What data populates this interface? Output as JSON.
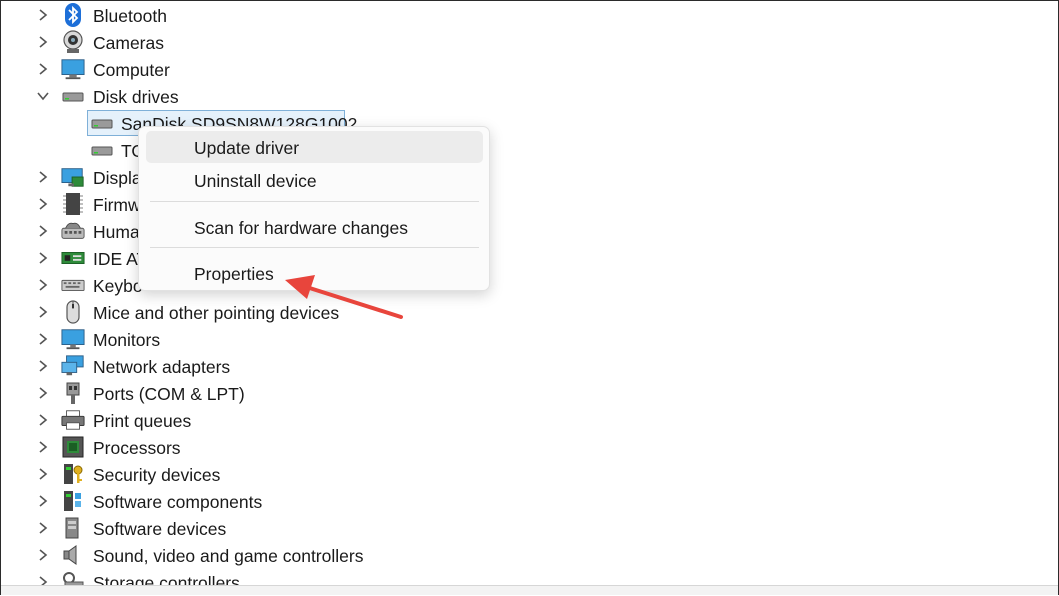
{
  "tree": {
    "items": [
      {
        "label": "Bluetooth",
        "icon": "bluetooth-icon",
        "expanded": false
      },
      {
        "label": "Cameras",
        "icon": "camera-icon",
        "expanded": false
      },
      {
        "label": "Computer",
        "icon": "computer-icon",
        "expanded": false
      },
      {
        "label": "Disk drives",
        "icon": "disk-drive-icon",
        "expanded": true
      },
      {
        "label": "SanDisk SD9SN8W128G1002",
        "icon": "disk-drive-icon",
        "child": true,
        "selected": true
      },
      {
        "label": "TO",
        "icon": "disk-drive-icon",
        "child": true
      },
      {
        "label": "Displa",
        "icon": "display-adapter-icon",
        "expanded": false
      },
      {
        "label": "Firmw",
        "icon": "firmware-icon",
        "expanded": false
      },
      {
        "label": "Huma",
        "icon": "hid-icon",
        "expanded": false
      },
      {
        "label": "IDE AT",
        "icon": "ide-controller-icon",
        "expanded": false
      },
      {
        "label": "Keybo",
        "icon": "keyboard-icon",
        "expanded": false
      },
      {
        "label": "Mice and other pointing devices",
        "icon": "mouse-icon",
        "expanded": false
      },
      {
        "label": "Monitors",
        "icon": "monitor-icon",
        "expanded": false
      },
      {
        "label": "Network adapters",
        "icon": "network-adapter-icon",
        "expanded": false
      },
      {
        "label": "Ports (COM & LPT)",
        "icon": "port-icon",
        "expanded": false
      },
      {
        "label": "Print queues",
        "icon": "printer-icon",
        "expanded": false
      },
      {
        "label": "Processors",
        "icon": "processor-icon",
        "expanded": false
      },
      {
        "label": "Security devices",
        "icon": "security-device-icon",
        "expanded": false
      },
      {
        "label": "Software components",
        "icon": "software-component-icon",
        "expanded": false
      },
      {
        "label": "Software devices",
        "icon": "software-device-icon",
        "expanded": false
      },
      {
        "label": "Sound, video and game controllers",
        "icon": "speaker-icon",
        "expanded": false
      },
      {
        "label": "Storage controllers",
        "icon": "storage-controller-icon",
        "expanded": false
      }
    ]
  },
  "context_menu": {
    "update_driver": "Update driver",
    "uninstall_device": "Uninstall device",
    "scan_hardware": "Scan for hardware changes",
    "properties": "Properties"
  },
  "colors": {
    "selection_bg": "#e5f1fb",
    "selection_border": "#7fb0d8",
    "annotation_arrow": "#e8453c"
  }
}
